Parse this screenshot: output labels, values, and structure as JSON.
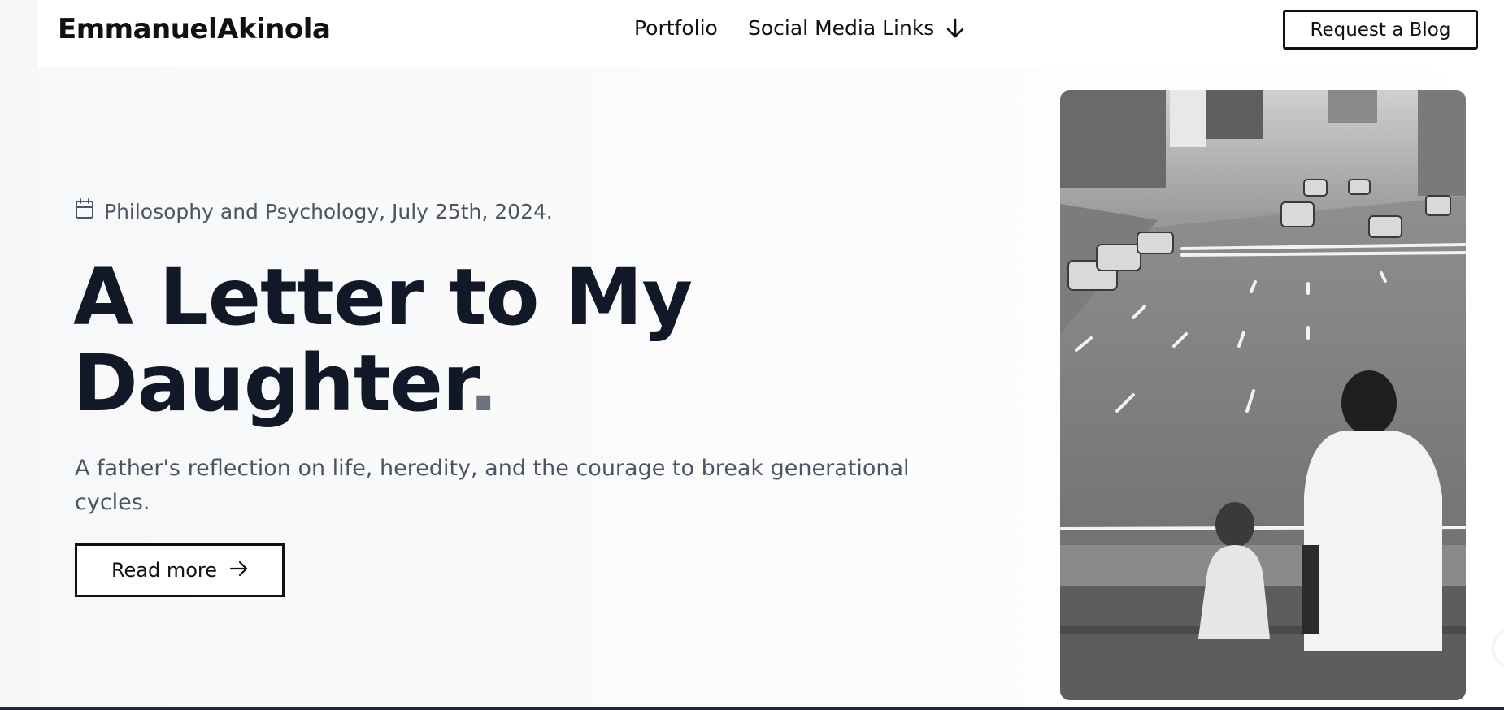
{
  "header": {
    "brand": "EmmanuelAkinola",
    "nav": {
      "portfolio": "Portfolio",
      "social": "Social Media Links",
      "social_icon": "arrow-down-icon"
    },
    "request_button": "Request a Blog"
  },
  "hero": {
    "meta_icon": "calendar-icon",
    "meta": "Philosophy and Psychology, July 25th, 2024.",
    "title": "A Letter to My Daughter",
    "title_dot": ".",
    "subtitle": "A father's reflection on life, heredity, and the courage to break generational cycles.",
    "read_more": "Read more",
    "read_more_icon": "arrow-right-icon",
    "image_alt": "Black and white photo of a father and young daughter sitting on a ledge overlooking a city street"
  },
  "colors": {
    "heading": "#111827",
    "muted": "#4b5563",
    "border": "#111111",
    "page_bg": "#f6f7f8"
  }
}
